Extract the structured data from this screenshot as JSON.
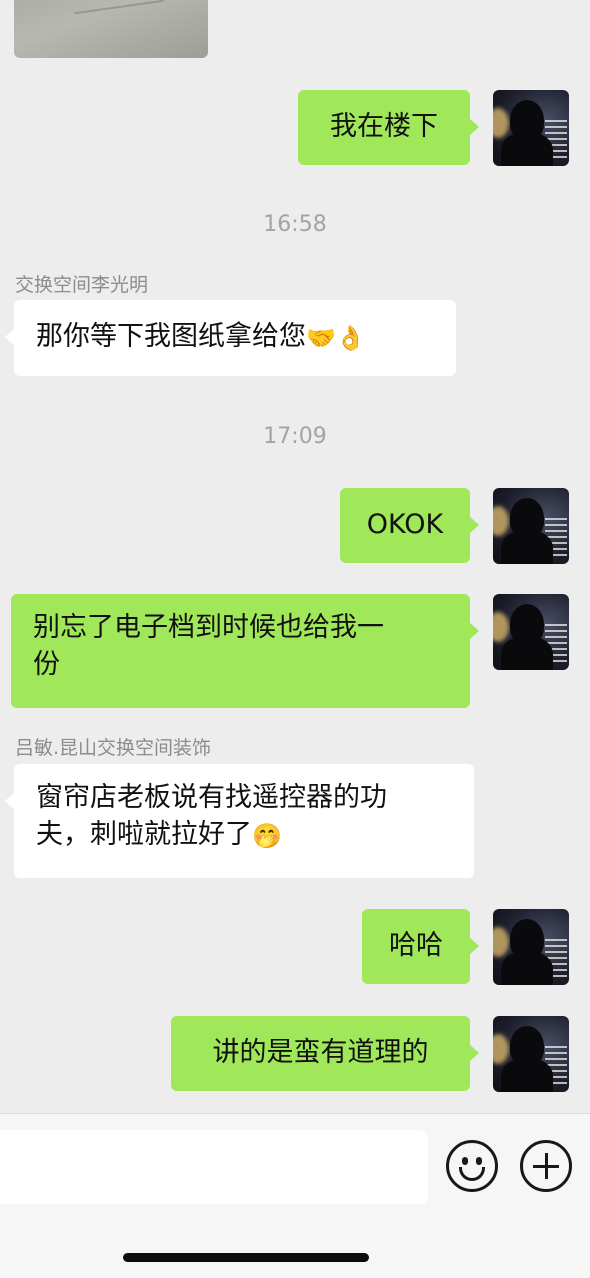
{
  "messages": [
    {
      "id": "m1",
      "side": "me",
      "text": "我在楼下"
    },
    {
      "time": "16:58"
    },
    {
      "id": "m2",
      "side": "other",
      "sender": "交换空间李光明",
      "text": "那你等下我图纸拿给您",
      "emojis": [
        "🤝",
        "👌"
      ]
    },
    {
      "time": "17:09"
    },
    {
      "id": "m3",
      "side": "me",
      "text": "OKOK"
    },
    {
      "id": "m4",
      "side": "me",
      "text_line1": "别忘了电子档到时候也给我一",
      "text_line2": "份"
    },
    {
      "id": "m5",
      "side": "other",
      "sender": "吕敏.昆山交换空间装饰",
      "text_line1": "窗帘店老板说有找遥控器的功",
      "text_line2": "夫，刺啦就拉好了",
      "emojis": [
        "🤭"
      ]
    },
    {
      "id": "m6",
      "side": "me",
      "text": "哈哈"
    },
    {
      "id": "m7",
      "side": "me",
      "text": "讲的是蛮有道理的"
    }
  ],
  "colors": {
    "background": "#ededed",
    "my_bubble": "#a0e75a",
    "other_bubble": "#ffffff",
    "timestamp": "#a3a3a3"
  },
  "icons": {
    "emoji_button": "smiley-face-icon",
    "more_button": "plus-circle-icon"
  }
}
